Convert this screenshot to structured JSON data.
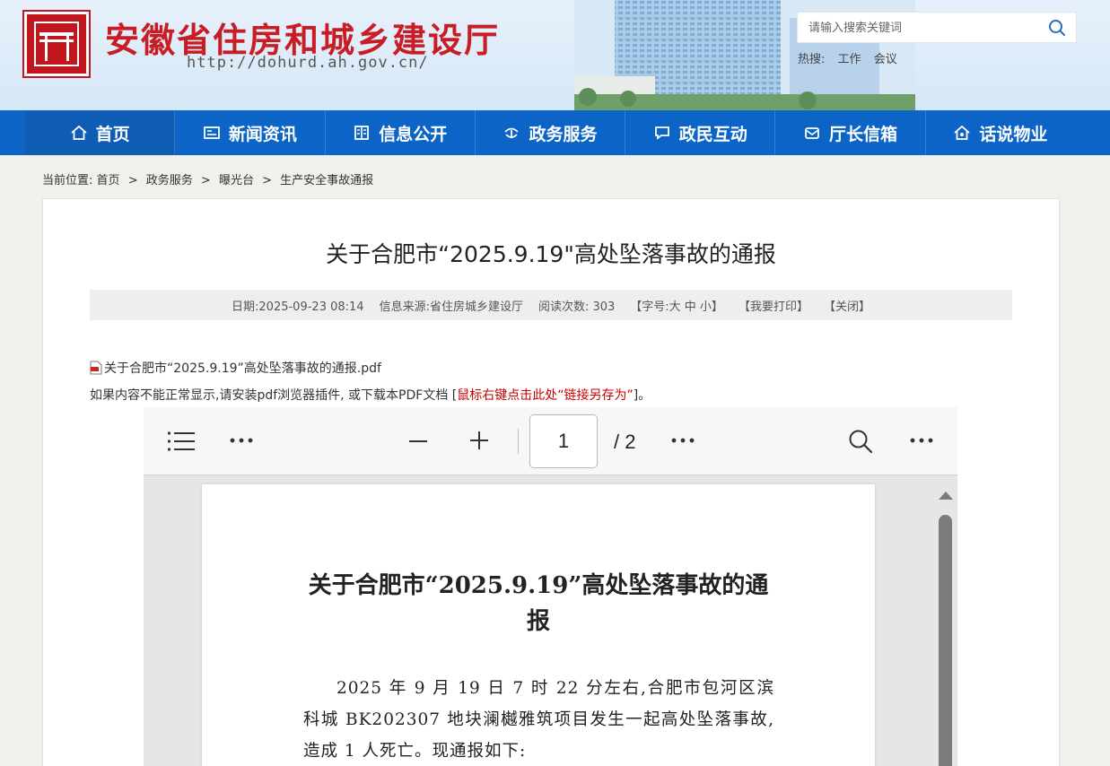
{
  "header": {
    "site_title": "安徽省住房和城乡建设厅",
    "site_url": "http://dohurd.ah.gov.cn/",
    "search_placeholder": "请输入搜索关键词",
    "hot_label": "热搜:",
    "hot_terms": [
      "工作",
      "会议"
    ]
  },
  "nav": {
    "items": [
      {
        "label": "首页",
        "icon": "home-icon"
      },
      {
        "label": "新闻资讯",
        "icon": "news-icon"
      },
      {
        "label": "信息公开",
        "icon": "book-icon"
      },
      {
        "label": "政务服务",
        "icon": "service-icon"
      },
      {
        "label": "政民互动",
        "icon": "chat-icon"
      },
      {
        "label": "厅长信箱",
        "icon": "mailbox-icon"
      },
      {
        "label": "话说物业",
        "icon": "property-icon"
      }
    ]
  },
  "breadcrumb": {
    "prefix": "当前位置:",
    "items": [
      "首页",
      "政务服务",
      "曝光台",
      "生产安全事故通报"
    ],
    "separator": ">"
  },
  "article": {
    "title": "关于合肥市“2025.9.19\"高处坠落事故的通报",
    "meta": {
      "date": "日期:2025-09-23 08:14",
      "source": "信息来源:省住房城乡建设厅",
      "reads": "阅读次数: 303",
      "font_size": "【字号:大 中 小】",
      "print": "【我要打印】",
      "close": "【关闭】"
    },
    "attachment_name": "关于合肥市“2025.9.19”高处坠落事故的通报.pdf",
    "notice_text": "如果内容不能正常显示,请安装pdf浏览器插件, 或下载本PDF文档 [",
    "notice_link": "鼠标右键点击此处“链接另存为”",
    "notice_end": "]。"
  },
  "pdf_viewer": {
    "current_page": "1",
    "total_pages": "/ 2",
    "doc_title": "关于合肥市“2025.9.19”高处坠落事故的通报",
    "doc_body": "2025 年 9 月 19 日 7 时 22 分左右,合肥市包河区滨科城 BK202307 地块澜樾雅筑项目发生一起高处坠落事故,造成 1 人死亡。现通报如下:"
  },
  "colors": {
    "brand_red": "#c81d24",
    "nav_blue": "#0c64c6",
    "link_red": "#cc0000"
  }
}
